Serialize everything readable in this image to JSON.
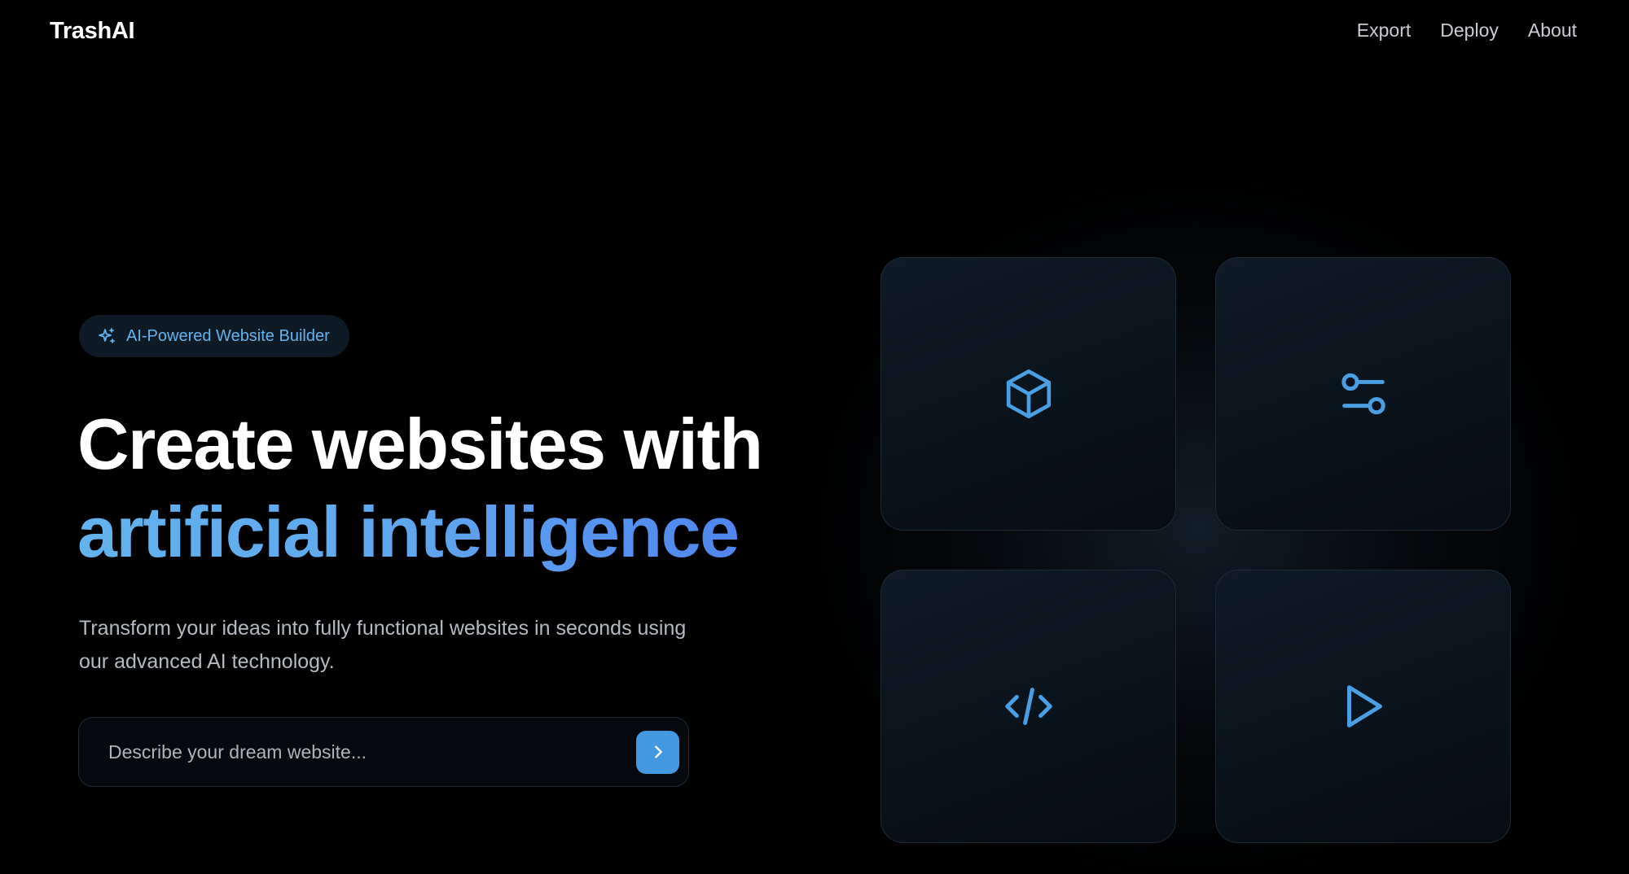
{
  "header": {
    "logo": "TrashAI",
    "nav": [
      "Export",
      "Deploy",
      "About"
    ]
  },
  "hero": {
    "badge": "AI-Powered Website Builder",
    "headline_line1": "Create websites with",
    "headline_line2": "artificial intelligence",
    "subtext": "Transform your ideas into fully functional websites in seconds using our advanced AI technology.",
    "prompt_placeholder": "Describe your dream website...",
    "send_icon": "chevron-right-icon"
  },
  "tiles": [
    {
      "icon": "cube-icon"
    },
    {
      "icon": "sliders-icon"
    },
    {
      "icon": "code-icon"
    },
    {
      "icon": "play-icon"
    }
  ],
  "colors": {
    "background": "#000000",
    "accent": "#63b3ed",
    "gradient_end": "#4e83ee",
    "button": "#4299e1",
    "tile_border": "#1d2a37"
  }
}
